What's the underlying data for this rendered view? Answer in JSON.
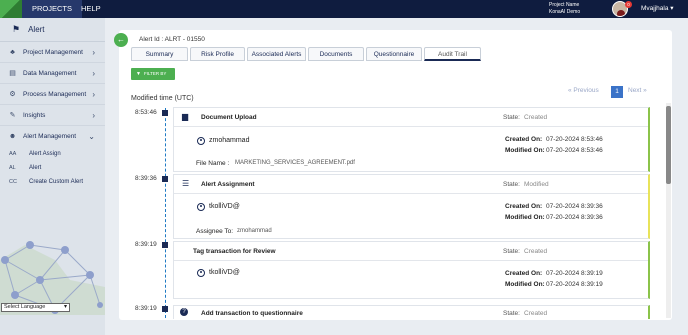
{
  "topbar": {
    "nav": [
      "PROJECTS",
      "HELP"
    ],
    "project_label": "Project Name",
    "project_value": "KonaAI Demo",
    "notification_count": "0",
    "user_name": "Mvajjhala ▾"
  },
  "sidebar": {
    "title": "Alert",
    "items": [
      {
        "label": "Project Management",
        "icon": "org-chart-icon"
      },
      {
        "label": "Data Management",
        "icon": "database-icon"
      },
      {
        "label": "Process Management",
        "icon": "gears-icon"
      },
      {
        "label": "Insights",
        "icon": "edit-icon"
      },
      {
        "label": "Alert Management",
        "icon": "users-icon"
      }
    ],
    "subitems": [
      {
        "abbr": "AA",
        "label": "Alert Assign"
      },
      {
        "abbr": "AL",
        "label": "Alert"
      },
      {
        "abbr": "CC",
        "label": "Create Custom Alert"
      }
    ],
    "language": "Select Language"
  },
  "main": {
    "alert_id": "Alert Id : ALRT - 01550",
    "tabs": [
      "Summary",
      "Risk Profile",
      "Associated Alerts",
      "Documents",
      "Questionnaire",
      "Audit Trail"
    ],
    "active_tab": "Audit Trail",
    "filter_label": "FILTER BY",
    "pager": {
      "previous": "« Previous",
      "page": "1",
      "next": "Next »"
    },
    "modified_heading": "Modified time (UTC)",
    "state_label": "State:",
    "created_on_label": "Created On:",
    "modified_on_label": "Modified On:"
  },
  "events": [
    {
      "time": "8:53:46",
      "title": "Document Upload",
      "icon": "document-icon",
      "state": "Created",
      "user": "zmohammad",
      "created_on": "07-20-2024 8:53:46",
      "modified_on": "07-20-2024 8:53:46",
      "extra_label": "File Name :",
      "extra_value": "MARKETING_SERVICES_AGREEMENT.pdf",
      "accent": "#8bc34a"
    },
    {
      "time": "8:39:36",
      "title": "Alert Assignment",
      "icon": "list-icon",
      "state": "Modified",
      "user": "tkolliVD@",
      "created_on": "07-20-2024 8:39:36",
      "modified_on": "07-20-2024 8:39:36",
      "extra_label": "Assignee To:",
      "extra_value": "zmohammad",
      "accent": "#e8e35a"
    },
    {
      "time": "8:39:19",
      "title": "Tag transaction for Review",
      "icon": "",
      "state": "Created",
      "user": "tkolliVD@",
      "created_on": "07-20-2024 8:39:19",
      "modified_on": "07-20-2024 8:39:19",
      "accent": "#8bc34a"
    },
    {
      "time": "8:39:19",
      "title": "Add transaction to questionnaire",
      "icon": "question-icon",
      "state": "Created",
      "accent": "#8bc34a"
    }
  ]
}
